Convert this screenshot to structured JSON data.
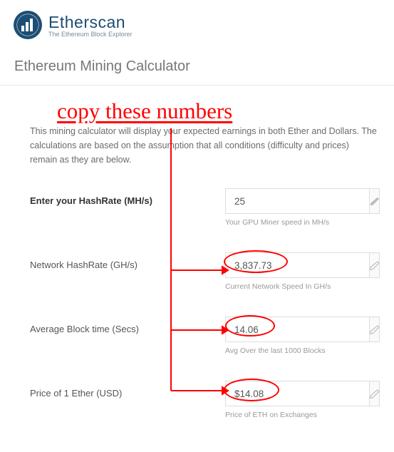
{
  "brand": {
    "name": "Etherscan",
    "tagline": "The Ethereum Block Explorer"
  },
  "page_title": "Ethereum Mining Calculator",
  "annotation": "copy these numbers",
  "intro": "This mining calculator will display your expected earnings in both Ether and Dollars. The calculations are based on the assumption that all conditions (difficulty and prices) remain as they are below.",
  "fields": {
    "hashrate": {
      "label": "Enter your HashRate (MH/s)",
      "value": "25",
      "helper": "Your GPU Miner speed in MH/s"
    },
    "network": {
      "label": "Network HashRate (GH/s)",
      "value": "3,837.73",
      "helper": "Current Network Speed In GH/s"
    },
    "blocktime": {
      "label": "Average Block time (Secs)",
      "value": "14.06",
      "helper": "Avg Over the last 1000 Blocks"
    },
    "price": {
      "label": "Price of 1 Ether (USD)",
      "value": "$14.08",
      "helper": "Price of ETH on Exchanges"
    }
  }
}
